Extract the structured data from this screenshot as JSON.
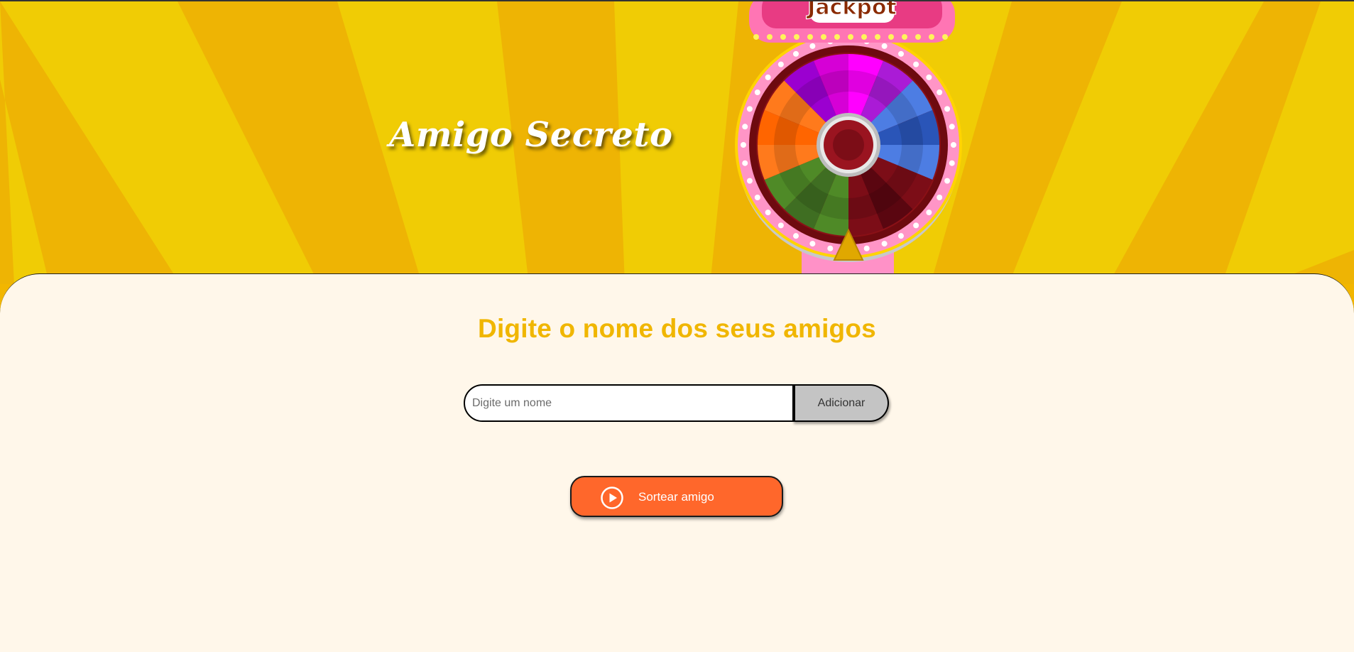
{
  "header": {
    "title": "Amigo Secreto",
    "wheel_sign": "Jackpot"
  },
  "main": {
    "heading": "Digite o nome dos seus amigos",
    "input": {
      "placeholder": "Digite um nome",
      "value": ""
    },
    "add_button_label": "Adicionar",
    "friends": [],
    "draw_button": {
      "label": "Sortear amigo",
      "icon": "play-circle-icon"
    }
  },
  "colors": {
    "ray_light": "#f0cc05",
    "ray_dark": "#eeb404",
    "main_background": "#fff7ea",
    "heading": "#f0b600",
    "draw_button": "#ff672b",
    "add_button": "#c4c4c4",
    "wheel_frame": "#ff9ccb"
  }
}
